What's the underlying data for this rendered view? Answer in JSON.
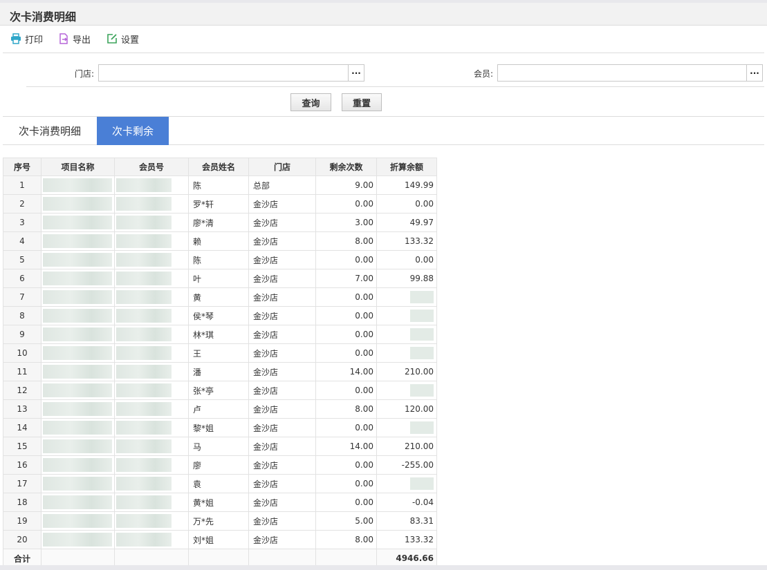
{
  "page": {
    "title": "次卡消费明细"
  },
  "toolbar": {
    "print_label": "打印",
    "export_label": "导出",
    "settings_label": "设置",
    "icon_colors": {
      "print": "#2fa6c9",
      "export": "#b565d8",
      "settings": "#3aa35a"
    }
  },
  "filters": {
    "store_label": "门店:",
    "store_value": "",
    "member_label": "会员:",
    "member_value": "",
    "browse_label": "···",
    "query_label": "查询",
    "reset_label": "重置"
  },
  "tabs": [
    {
      "label": "次卡消费明细",
      "active": false
    },
    {
      "label": "次卡剩余",
      "active": true
    }
  ],
  "accent_color": "#4a7fd6",
  "table": {
    "columns": [
      "序号",
      "项目名称",
      "会员号",
      "会员姓名",
      "门店",
      "剩余次数",
      "折算余额"
    ],
    "rows": [
      {
        "idx": "1",
        "name": "陈",
        "store": "总部",
        "remaining": "9.00",
        "balance": "149.99"
      },
      {
        "idx": "2",
        "name": "罗*轩",
        "store": "金沙店",
        "remaining": "0.00",
        "balance": "0.00"
      },
      {
        "idx": "3",
        "name": "廖*清",
        "store": "金沙店",
        "remaining": "3.00",
        "balance": "49.97"
      },
      {
        "idx": "4",
        "name": "赖",
        "store": "金沙店",
        "remaining": "8.00",
        "balance": "133.32"
      },
      {
        "idx": "5",
        "name": "陈",
        "store": "金沙店",
        "remaining": "0.00",
        "balance": "0.00"
      },
      {
        "idx": "6",
        "name": "叶",
        "store": "金沙店",
        "remaining": "7.00",
        "balance": "99.88"
      },
      {
        "idx": "7",
        "name": "黄",
        "store": "金沙店",
        "remaining": "0.00",
        "balance": ""
      },
      {
        "idx": "8",
        "name": "侯*琴",
        "store": "金沙店",
        "remaining": "0.00",
        "balance": ""
      },
      {
        "idx": "9",
        "name": "林*琪",
        "store": "金沙店",
        "remaining": "0.00",
        "balance": ""
      },
      {
        "idx": "10",
        "name": "王",
        "store": "金沙店",
        "remaining": "0.00",
        "balance": ""
      },
      {
        "idx": "11",
        "name": "潘",
        "store": "金沙店",
        "remaining": "14.00",
        "balance": "210.00"
      },
      {
        "idx": "12",
        "name": "张*亭",
        "store": "金沙店",
        "remaining": "0.00",
        "balance": ""
      },
      {
        "idx": "13",
        "name": "卢",
        "store": "金沙店",
        "remaining": "8.00",
        "balance": "120.00"
      },
      {
        "idx": "14",
        "name": "黎*姐",
        "store": "金沙店",
        "remaining": "0.00",
        "balance": ""
      },
      {
        "idx": "15",
        "name": "马",
        "store": "金沙店",
        "remaining": "14.00",
        "balance": "210.00"
      },
      {
        "idx": "16",
        "name": "廖",
        "store": "金沙店",
        "remaining": "0.00",
        "balance": "-255.00"
      },
      {
        "idx": "17",
        "name": "袁",
        "store": "金沙店",
        "remaining": "0.00",
        "balance": ""
      },
      {
        "idx": "18",
        "name": "黄*姐",
        "store": "金沙店",
        "remaining": "0.00",
        "balance": "-0.04"
      },
      {
        "idx": "19",
        "name": "万*先",
        "store": "金沙店",
        "remaining": "5.00",
        "balance": "83.31"
      },
      {
        "idx": "20",
        "name": "刘*姐",
        "store": "金沙店",
        "remaining": "8.00",
        "balance": "133.32"
      }
    ],
    "total": {
      "label": "合计",
      "balance": "4946.66"
    }
  }
}
